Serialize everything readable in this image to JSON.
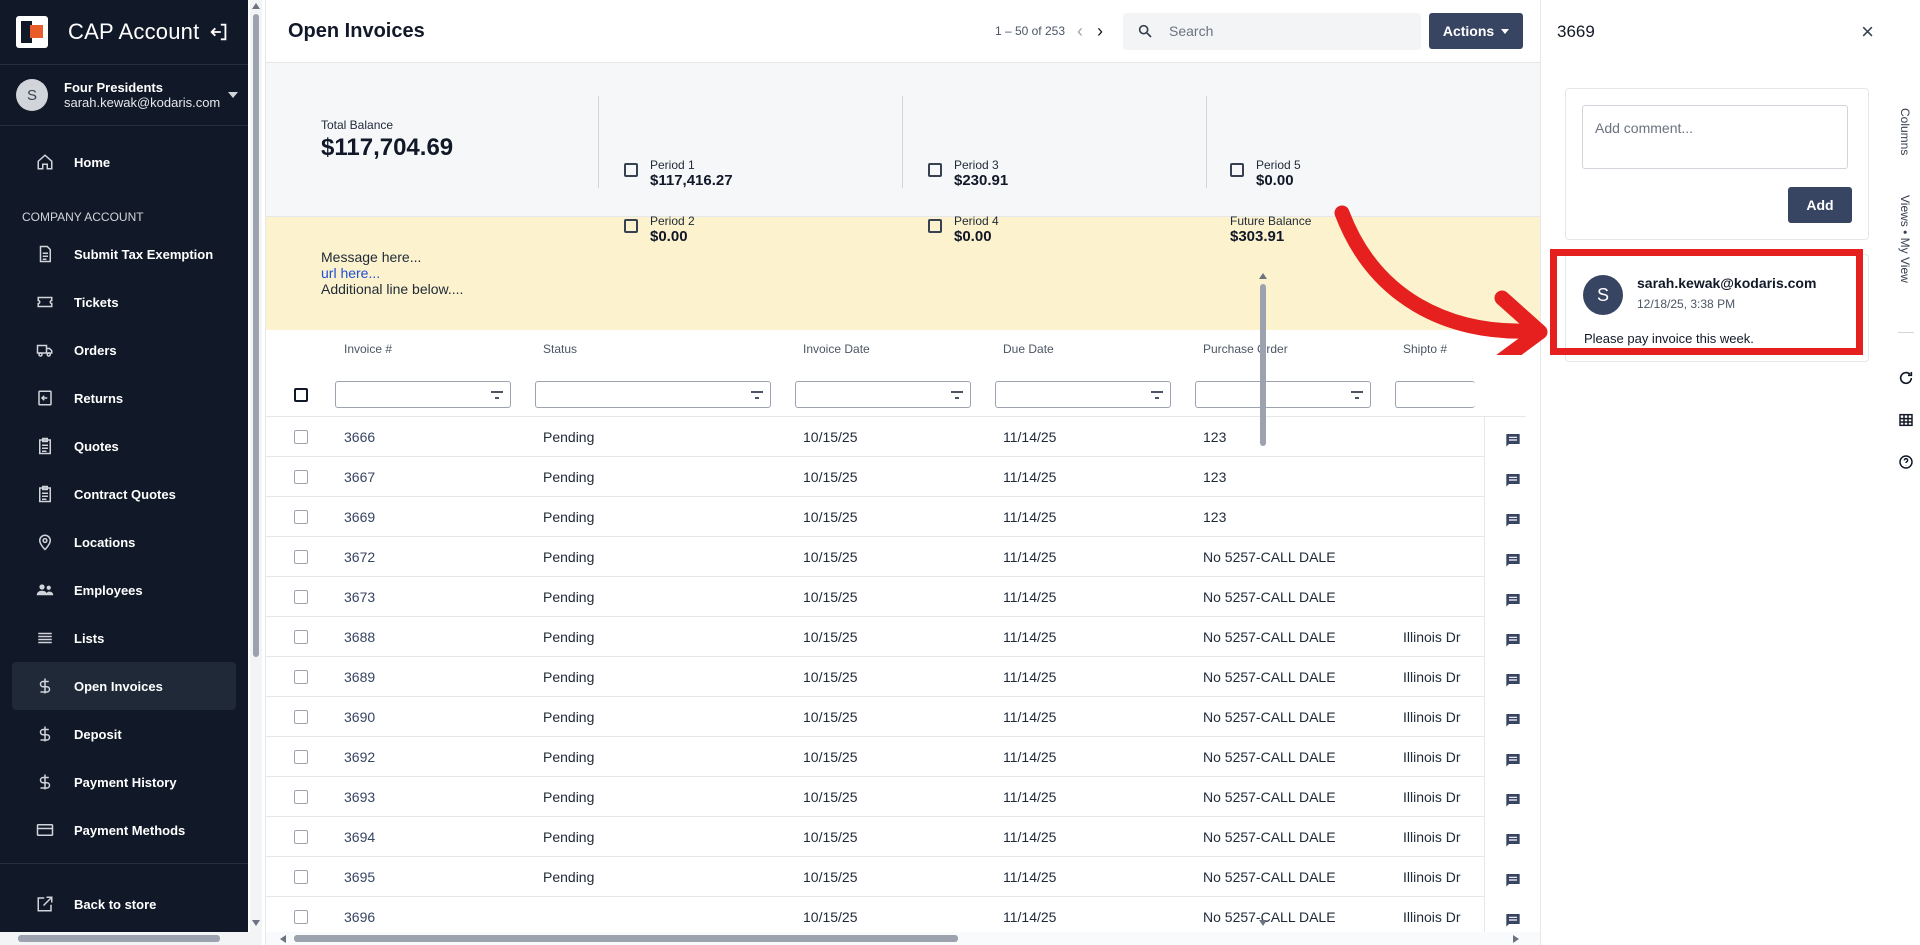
{
  "app": {
    "title": "CAP Account"
  },
  "user": {
    "initial": "S",
    "company": "Four Presidents",
    "email": "sarah.kewak@kodaris.com"
  },
  "nav": {
    "home": "Home",
    "section": "COMPANY ACCOUNT",
    "items": [
      "Submit Tax Exemption",
      "Tickets",
      "Orders",
      "Returns",
      "Quotes",
      "Contract Quotes",
      "Locations",
      "Employees",
      "Lists",
      "Open Invoices",
      "Deposit",
      "Payment History",
      "Payment Methods"
    ],
    "active": "Open Invoices",
    "back": "Back to store"
  },
  "topbar": {
    "title": "Open Invoices",
    "pager": "1 – 50 of 253",
    "search_placeholder": "Search",
    "actions_label": "Actions"
  },
  "balance": {
    "total_label": "Total Balance",
    "total_value": "$117,704.69",
    "period1_label": "Period 1",
    "period1_value": "$117,416.27",
    "period2_label": "Period 2",
    "period2_value": "$0.00",
    "period3_label": "Period 3",
    "period3_value": "$230.91",
    "period4_label": "Period 4",
    "period4_value": "$0.00",
    "period5_label": "Period 5",
    "period5_value": "$0.00",
    "future_label": "Future Balance",
    "future_value": "$303.91"
  },
  "message": {
    "line1": "Message here...",
    "url": "url here...",
    "line3": "Additional line below...."
  },
  "table": {
    "columns": [
      "Invoice #",
      "Status",
      "Invoice Date",
      "Due Date",
      "Purchase Order",
      "Shipto #"
    ],
    "rows": [
      {
        "invoice": "3666",
        "status": "Pending",
        "invoice_date": "10/15/25",
        "due_date": "11/14/25",
        "po": "123",
        "shipto": ""
      },
      {
        "invoice": "3667",
        "status": "Pending",
        "invoice_date": "10/15/25",
        "due_date": "11/14/25",
        "po": "123",
        "shipto": ""
      },
      {
        "invoice": "3669",
        "status": "Pending",
        "invoice_date": "10/15/25",
        "due_date": "11/14/25",
        "po": "123",
        "shipto": ""
      },
      {
        "invoice": "3672",
        "status": "Pending",
        "invoice_date": "10/15/25",
        "due_date": "11/14/25",
        "po": "No 5257-CALL DALE",
        "shipto": ""
      },
      {
        "invoice": "3673",
        "status": "Pending",
        "invoice_date": "10/15/25",
        "due_date": "11/14/25",
        "po": "No 5257-CALL DALE",
        "shipto": ""
      },
      {
        "invoice": "3688",
        "status": "Pending",
        "invoice_date": "10/15/25",
        "due_date": "11/14/25",
        "po": "No 5257-CALL DALE",
        "shipto": "Illinois Dr"
      },
      {
        "invoice": "3689",
        "status": "Pending",
        "invoice_date": "10/15/25",
        "due_date": "11/14/25",
        "po": "No 5257-CALL DALE",
        "shipto": "Illinois Dr"
      },
      {
        "invoice": "3690",
        "status": "Pending",
        "invoice_date": "10/15/25",
        "due_date": "11/14/25",
        "po": "No 5257-CALL DALE",
        "shipto": "Illinois Dr"
      },
      {
        "invoice": "3692",
        "status": "Pending",
        "invoice_date": "10/15/25",
        "due_date": "11/14/25",
        "po": "No 5257-CALL DALE",
        "shipto": "Illinois Dr"
      },
      {
        "invoice": "3693",
        "status": "Pending",
        "invoice_date": "10/15/25",
        "due_date": "11/14/25",
        "po": "No 5257-CALL DALE",
        "shipto": "Illinois Dr"
      },
      {
        "invoice": "3694",
        "status": "Pending",
        "invoice_date": "10/15/25",
        "due_date": "11/14/25",
        "po": "No 5257-CALL DALE",
        "shipto": "Illinois Dr"
      },
      {
        "invoice": "3695",
        "status": "Pending",
        "invoice_date": "10/15/25",
        "due_date": "11/14/25",
        "po": "No 5257-CALL DALE",
        "shipto": "Illinois Dr"
      },
      {
        "invoice": "3696",
        "status": "",
        "invoice_date": "10/15/25",
        "due_date": "11/14/25",
        "po": "No 5257-CALL DALE",
        "shipto": "Illinois Dr"
      }
    ]
  },
  "panel": {
    "title": "3669",
    "comment_placeholder": "Add comment...",
    "add_label": "Add",
    "comment": {
      "initial": "S",
      "author": "sarah.kewak@kodaris.com",
      "time": "12/18/25, 3:38 PM",
      "text": "Please pay invoice this week."
    }
  },
  "sidetabs": {
    "columns": "Columns",
    "views": "Views • My View"
  },
  "colors": {
    "sidebar": "#111827",
    "accent": "#374462",
    "message_bg": "#fcf2cd",
    "annotation": "#e5201e"
  }
}
